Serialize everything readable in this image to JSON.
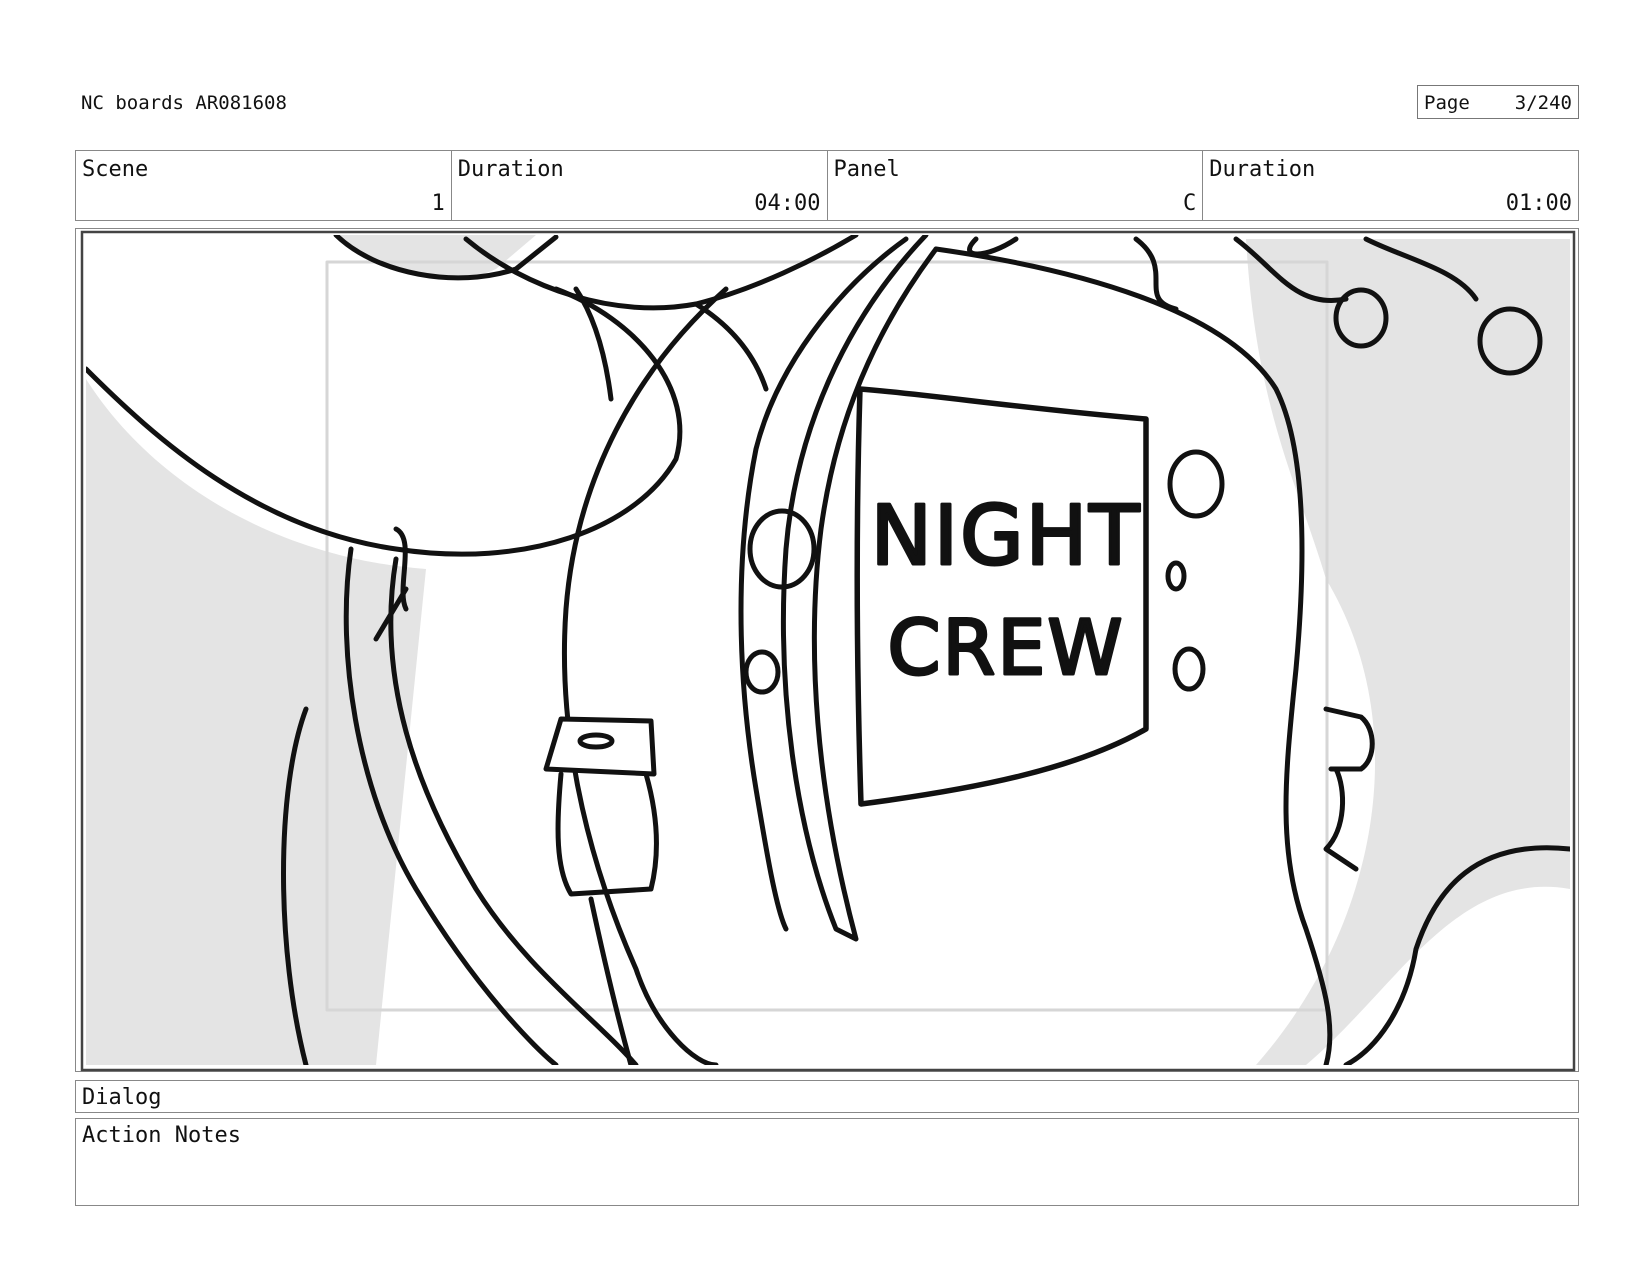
{
  "header": {
    "doc_title": "NC boards AR081608",
    "page_label": "Page",
    "page_value": "3/240"
  },
  "info": {
    "scene_label": "Scene",
    "scene_value": "1",
    "scene_duration_label": "Duration",
    "scene_duration_value": "04:00",
    "panel_label": "Panel",
    "panel_value": "C",
    "panel_duration_label": "Duration",
    "panel_duration_value": "01:00"
  },
  "panel": {
    "sign_line1": "NIGHT",
    "sign_line2": "CREW"
  },
  "dialog": {
    "label": "Dialog"
  },
  "notes": {
    "label": "Action Notes"
  }
}
